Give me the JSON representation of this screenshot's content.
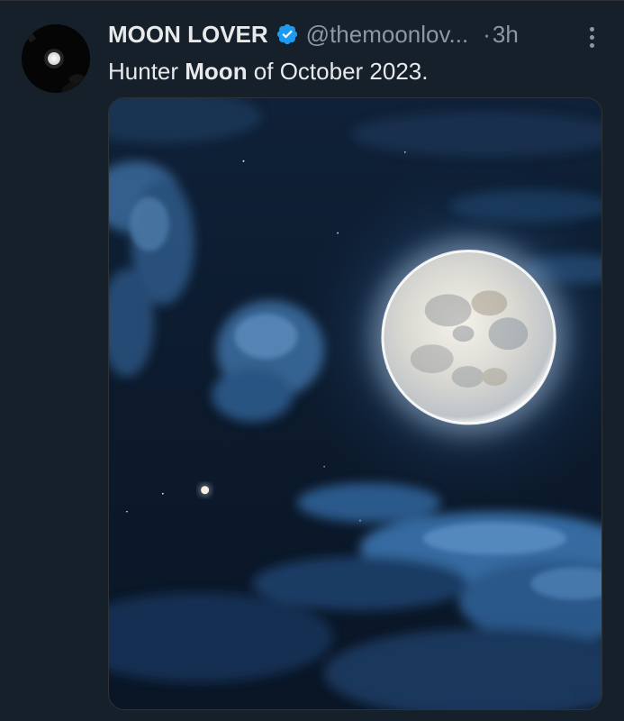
{
  "tweet": {
    "author_name": "MOON LOVER",
    "handle": "@themoonlov...",
    "separator": "·",
    "time_ago": "3h",
    "text_before": "Hunter ",
    "text_bold": "Moon",
    "text_after": " of October 2023.",
    "verified": true
  },
  "icons": {
    "verified": "verified-badge-icon",
    "more": "more-options-icon"
  },
  "colors": {
    "background": "#15202b",
    "primary_text": "#e7e9ea",
    "secondary_text": "#8b98a5",
    "verified_blue": "#1d9bf0"
  }
}
